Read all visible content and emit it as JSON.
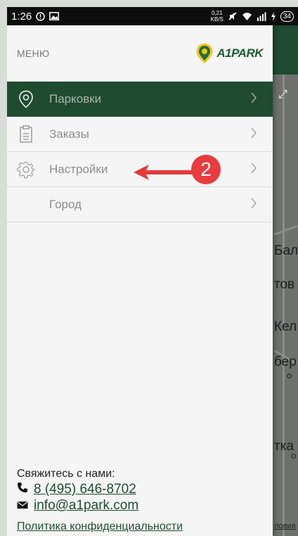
{
  "status_bar": {
    "time": "1:26",
    "net_speed_value": "0,21",
    "net_speed_unit": "KB/S",
    "battery": "34"
  },
  "drawer": {
    "title": "МЕНЮ",
    "logo_text": "A1PARK",
    "items": [
      {
        "label": "Парковки",
        "active": true
      },
      {
        "label": "Заказы",
        "active": false
      },
      {
        "label": "Настройки",
        "active": false
      },
      {
        "label": "Город",
        "active": false
      }
    ]
  },
  "annotation": {
    "badge": "2"
  },
  "contact": {
    "title": "Свяжитесь с нами:",
    "phone": "8 (495) 646-8702",
    "email": "info@a1park.com",
    "privacy": "Политика конфиденциальности"
  },
  "map": {
    "labels": [
      "Бал",
      "тов",
      "Кел",
      "бер",
      "о",
      "тка",
      "о"
    ],
    "bottom_text": "ловия"
  },
  "colors": {
    "primary_green": "#1f4b31",
    "accent_red": "#ea3b3e",
    "logo_yellow": "#f2c51b"
  },
  "icons": {
    "parking": "map-pin-icon",
    "orders": "clipboard-icon",
    "settings": "gear-icon",
    "chevron": "chevron-right-icon",
    "phone": "phone-icon",
    "email": "envelope-icon"
  }
}
